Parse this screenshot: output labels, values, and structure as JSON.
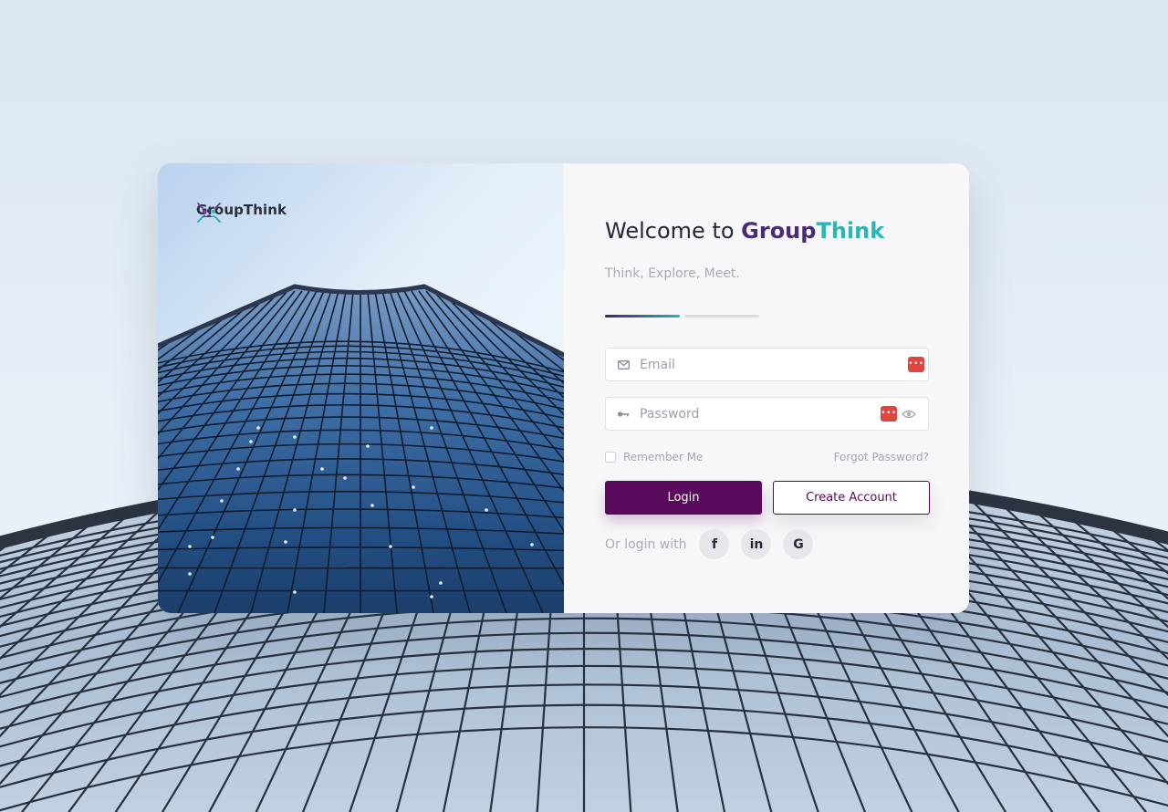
{
  "brand": {
    "name": "GroupThink"
  },
  "welcome": {
    "prefix": "Welcome to",
    "brand_part1": "Group",
    "brand_part2": "Think",
    "tagline": "Think, Explore, Meet."
  },
  "form": {
    "email": {
      "placeholder": "Email",
      "icon": "envelope-icon"
    },
    "password": {
      "placeholder": "Password",
      "icon": "key-icon"
    },
    "remember_label": "Remember Me",
    "forgot_label": "Forgot Password?",
    "login_label": "Login",
    "create_label": "Create Account",
    "password_manager_badge": "•••"
  },
  "social": {
    "label": "Or login with",
    "facebook": "f",
    "linkedin": "in",
    "google": "G"
  },
  "colors": {
    "primary": "#5a0a5c",
    "accent_teal": "#2ab5b7",
    "brand_purple": "#4b2a77",
    "badge_red": "#e0463f"
  }
}
